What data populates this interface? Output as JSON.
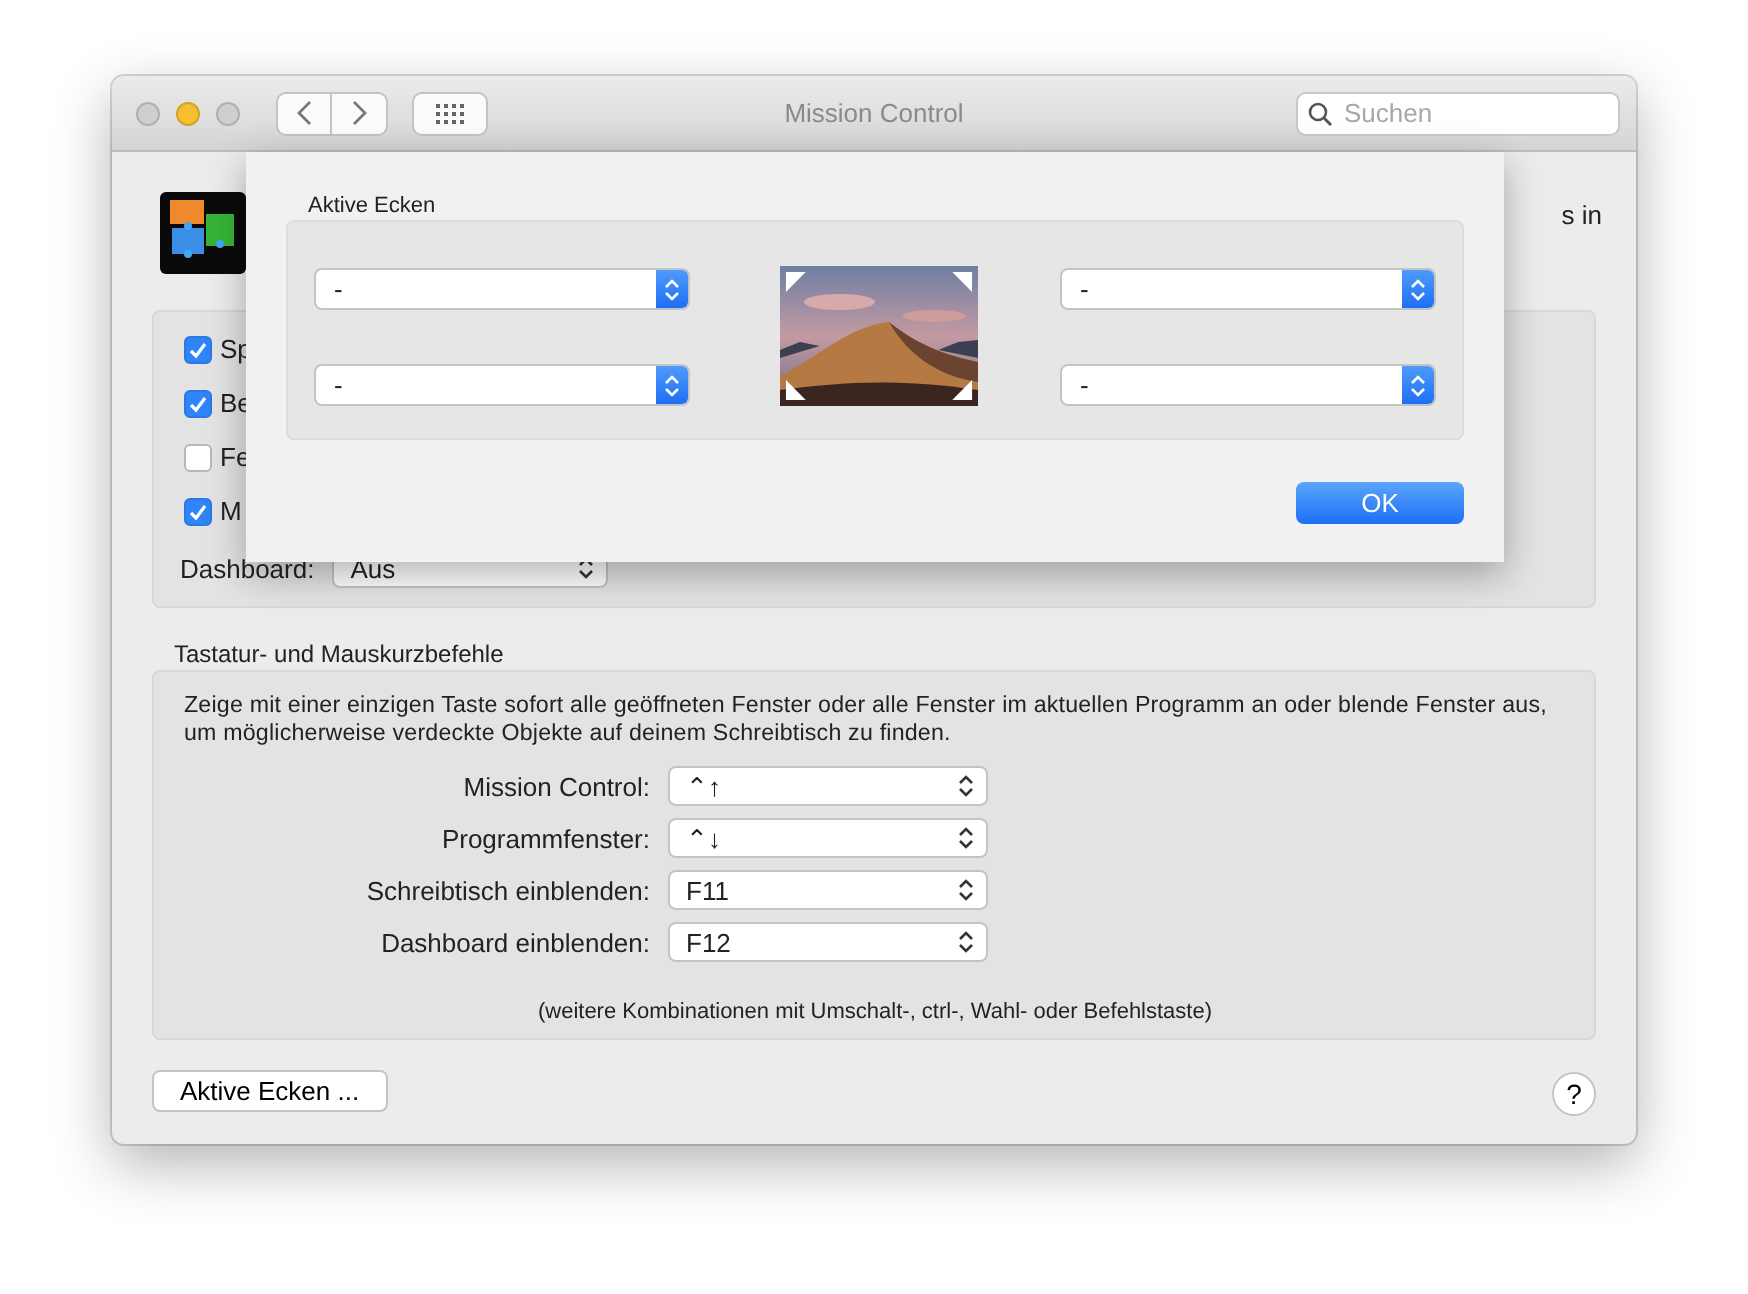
{
  "window": {
    "title": "Mission Control",
    "search": {
      "placeholder": "Suchen"
    }
  },
  "header": {
    "text_tail": "s in"
  },
  "options": [
    {
      "label": "Sp",
      "checked": true
    },
    {
      "label": "Be",
      "checked": true
    },
    {
      "label": "Fe",
      "checked": false
    },
    {
      "label": "M",
      "checked": true
    }
  ],
  "dashboard": {
    "label": "Dashboard:",
    "value": "Aus"
  },
  "shortcuts": {
    "title": "Tastatur- und Mauskurzbefehle",
    "description": "Zeige mit einer einzigen Taste sofort alle geöffneten Fenster oder alle Fenster im aktuellen Programm an oder blende Fenster aus, um möglicherweise verdeckte Objekte auf deinem Schreibtisch zu finden.",
    "rows": [
      {
        "label": "Mission Control:",
        "value": "⌃↑"
      },
      {
        "label": "Programmfenster:",
        "value": "⌃↓"
      },
      {
        "label": "Schreibtisch einblenden:",
        "value": "F11"
      },
      {
        "label": "Dashboard einblenden:",
        "value": "F12"
      }
    ],
    "note": "(weitere Kombinationen mit Umschalt-, ctrl-, Wahl- oder Befehlstaste)"
  },
  "buttons": {
    "hot_corners": "Aktive Ecken ...",
    "help": "?"
  },
  "sheet": {
    "title": "Aktive Ecken",
    "corners": [
      {
        "value": "-"
      },
      {
        "value": "-"
      },
      {
        "value": "-"
      },
      {
        "value": "-"
      }
    ],
    "ok": "OK"
  }
}
